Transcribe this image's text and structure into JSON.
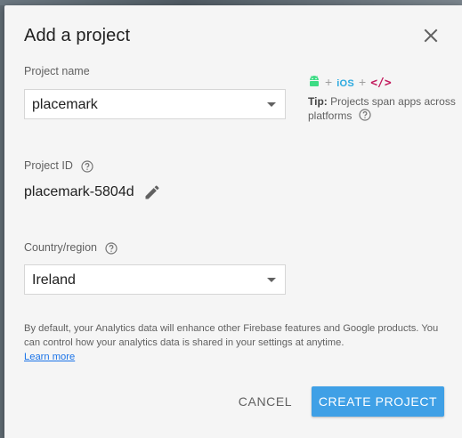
{
  "dialog": {
    "title": "Add a project"
  },
  "project_name": {
    "label": "Project name",
    "value": "placemark"
  },
  "tip": {
    "ios": "iOS",
    "web": "</>",
    "plus": "+",
    "bold": "Tip:",
    "text": " Projects span apps across platforms"
  },
  "project_id": {
    "label": "Project ID",
    "value": "placemark-5804d"
  },
  "country": {
    "label": "Country/region",
    "value": "Ireland"
  },
  "disclaimer": {
    "text": "By default, your Analytics data will enhance other Firebase features and Google products. You can control how your analytics data is shared in your settings at anytime. ",
    "link": "Learn more"
  },
  "actions": {
    "cancel": "CANCEL",
    "create": "CREATE PROJECT"
  },
  "colors": {
    "primary_button": "#3fa0e6",
    "android_green": "#3ddc84",
    "ios_blue": "#2aa9e0",
    "web_pink": "#c2185b",
    "link": "#1a73e8"
  },
  "icons": {
    "close": "close-icon",
    "help": "help-circle-icon",
    "edit": "pencil-icon",
    "android": "android-icon",
    "dropdown": "caret-down-icon"
  }
}
